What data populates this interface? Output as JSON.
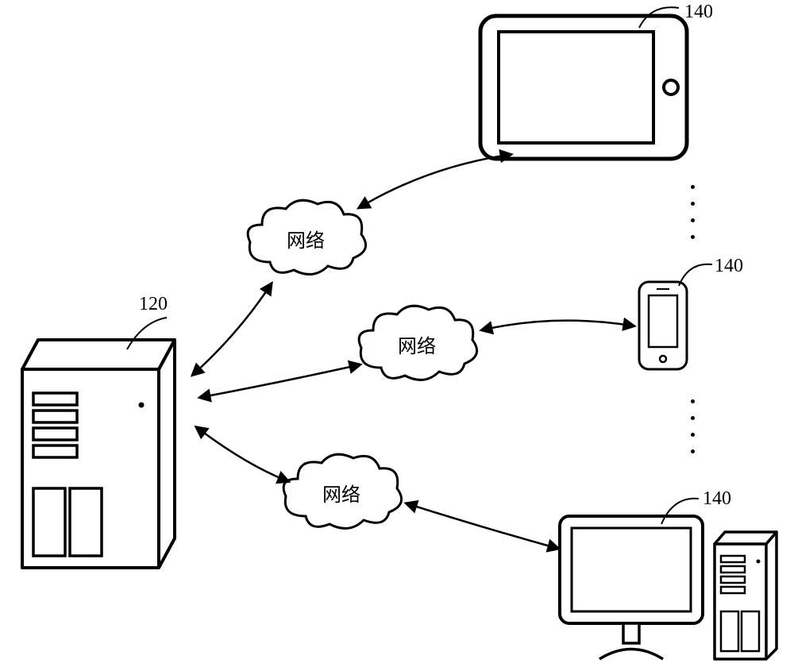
{
  "labels": {
    "server": "120",
    "tablet": "140",
    "phone": "140",
    "pc": "140"
  },
  "clouds": {
    "top": "网络",
    "mid": "网络",
    "bot": "网络"
  }
}
